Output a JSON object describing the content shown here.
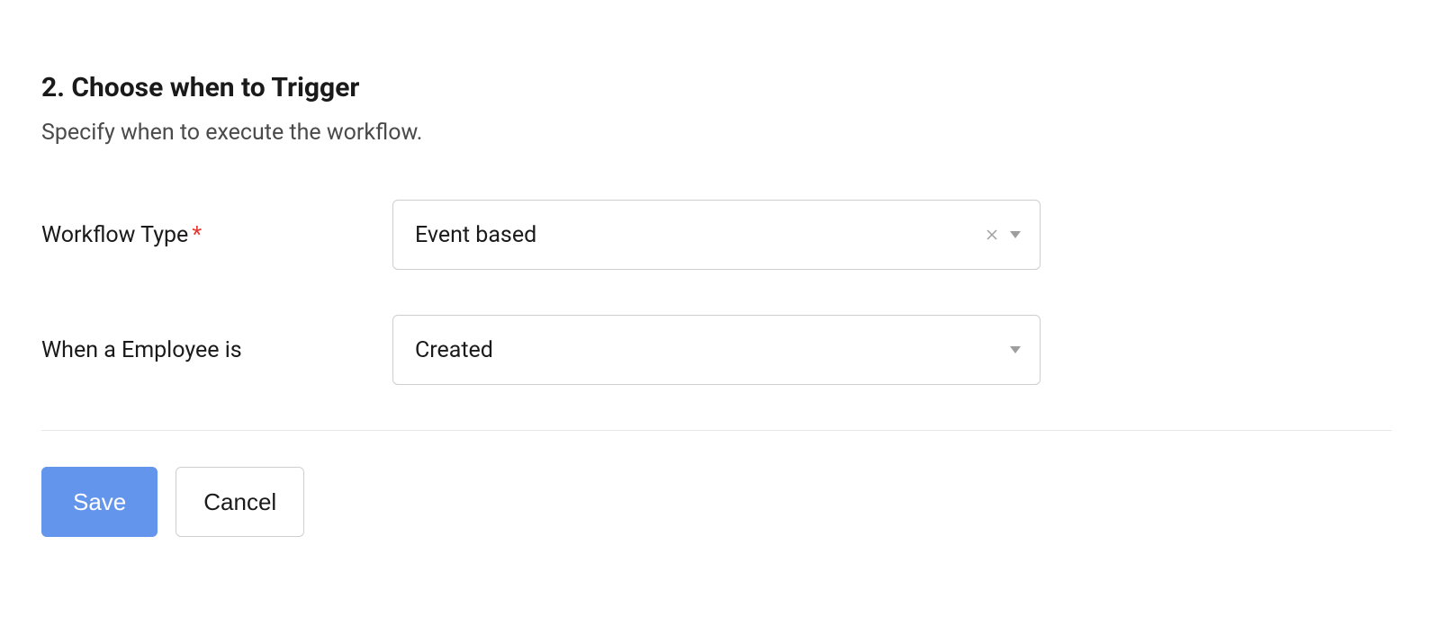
{
  "section": {
    "title": "2. Choose when to Trigger",
    "subtitle": "Specify when to execute the workflow."
  },
  "fields": {
    "workflow_type": {
      "label": "Workflow Type",
      "required_marker": "*",
      "value": "Event based"
    },
    "when_employee": {
      "label": "When a Employee is",
      "value": "Created"
    }
  },
  "buttons": {
    "save": "Save",
    "cancel": "Cancel"
  }
}
